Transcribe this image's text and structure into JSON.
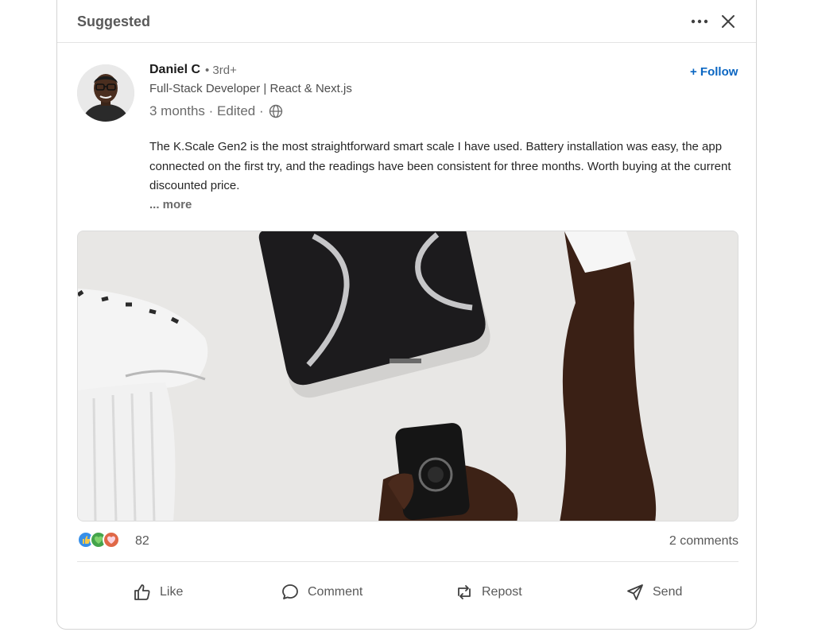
{
  "card": {
    "header_title": "Suggested",
    "more_icon": "ellipsis-icon",
    "close_icon": "close-icon"
  },
  "author": {
    "name": "Daniel C",
    "degree": "• 3rd+",
    "headline": "Full-Stack Developer | React & Next.js",
    "meta": "3 months · Edited ·",
    "follow_label": "+ Follow"
  },
  "post": {
    "text": "The K.Scale Gen2 is the most straightforward smart scale I have used. Battery installation was easy, the app connected on the first try, and the readings have been consistent for three months. Worth buying at the current discounted price.",
    "see_more": "... more"
  },
  "social": {
    "reaction_count": "82",
    "comments": "2 comments"
  },
  "actions": {
    "like": "Like",
    "comment": "Comment",
    "repost": "Repost",
    "send": "Send"
  },
  "colors": {
    "accent": "#0a66c2",
    "like": "#378fe9",
    "celebrate": "#44a44b",
    "love": "#e06847"
  }
}
